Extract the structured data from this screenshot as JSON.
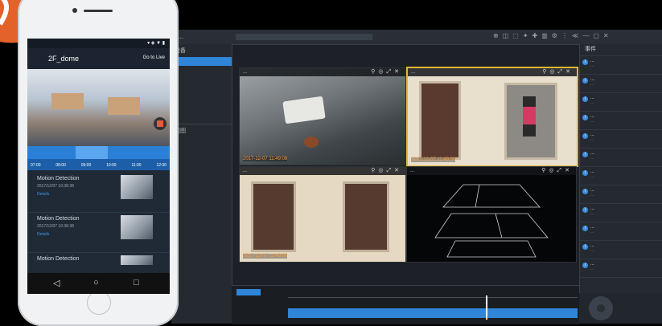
{
  "desktop": {
    "window_title": "...",
    "toolbar_items": [
      "⊕",
      "◫",
      "⬚",
      "✦",
      "✚",
      "▥",
      "⚙",
      "⋮",
      "≪",
      "—",
      "▢",
      "✕"
    ],
    "sidebar": {
      "section1_title": "设备",
      "section1_items": [
        "...",
        "...",
        "..."
      ],
      "section2_title": "视图",
      "section2_items": [
        "...",
        "...",
        "...",
        "...",
        "...",
        "...",
        "...",
        "..."
      ]
    },
    "videos": [
      {
        "title": "...",
        "timestamp": "2017-12-07 11:49:08"
      },
      {
        "title": "...",
        "timestamp": "2017-12-07 11:49:08"
      },
      {
        "title": "...",
        "timestamp": "2017-12-07 11:49:08"
      },
      {
        "title": "...",
        "timestamp": ""
      }
    ],
    "right_panel": {
      "title": "事件",
      "alarms": [
        {
          "name": "...",
          "detail": "..."
        },
        {
          "name": "...",
          "detail": "..."
        },
        {
          "name": "...",
          "detail": "..."
        },
        {
          "name": "...",
          "detail": "..."
        },
        {
          "name": "...",
          "detail": "..."
        },
        {
          "name": "...",
          "detail": "..."
        },
        {
          "name": "...",
          "detail": "..."
        },
        {
          "name": "...",
          "detail": "..."
        },
        {
          "name": "...",
          "detail": "..."
        },
        {
          "name": "...",
          "detail": "..."
        },
        {
          "name": "...",
          "detail": "..."
        },
        {
          "name": "...",
          "detail": "..."
        }
      ]
    }
  },
  "phone": {
    "status_right": "▾ ◈ ▼ ▮",
    "camera_name": "2F_dome",
    "go_to_live": "Go to Live",
    "timeline_labels": [
      "07:00",
      "08:00",
      "09:00",
      "10:00",
      "11:00",
      "12:00"
    ],
    "alerts": [
      {
        "title": "Motion Detection",
        "datetime": "2017/12/07 10:38:38",
        "link": "Details"
      },
      {
        "title": "Motion Detection",
        "datetime": "2017/12/07 10:38:38",
        "link": "Details"
      },
      {
        "title": "Motion Detection",
        "datetime": "",
        "link": ""
      }
    ],
    "nav": {
      "back": "◁",
      "home": "○",
      "recent": "□"
    }
  },
  "colors": {
    "accent": "#2f86d8",
    "selected_border": "#e1b53a",
    "timestamp": "#ff9b3c"
  }
}
